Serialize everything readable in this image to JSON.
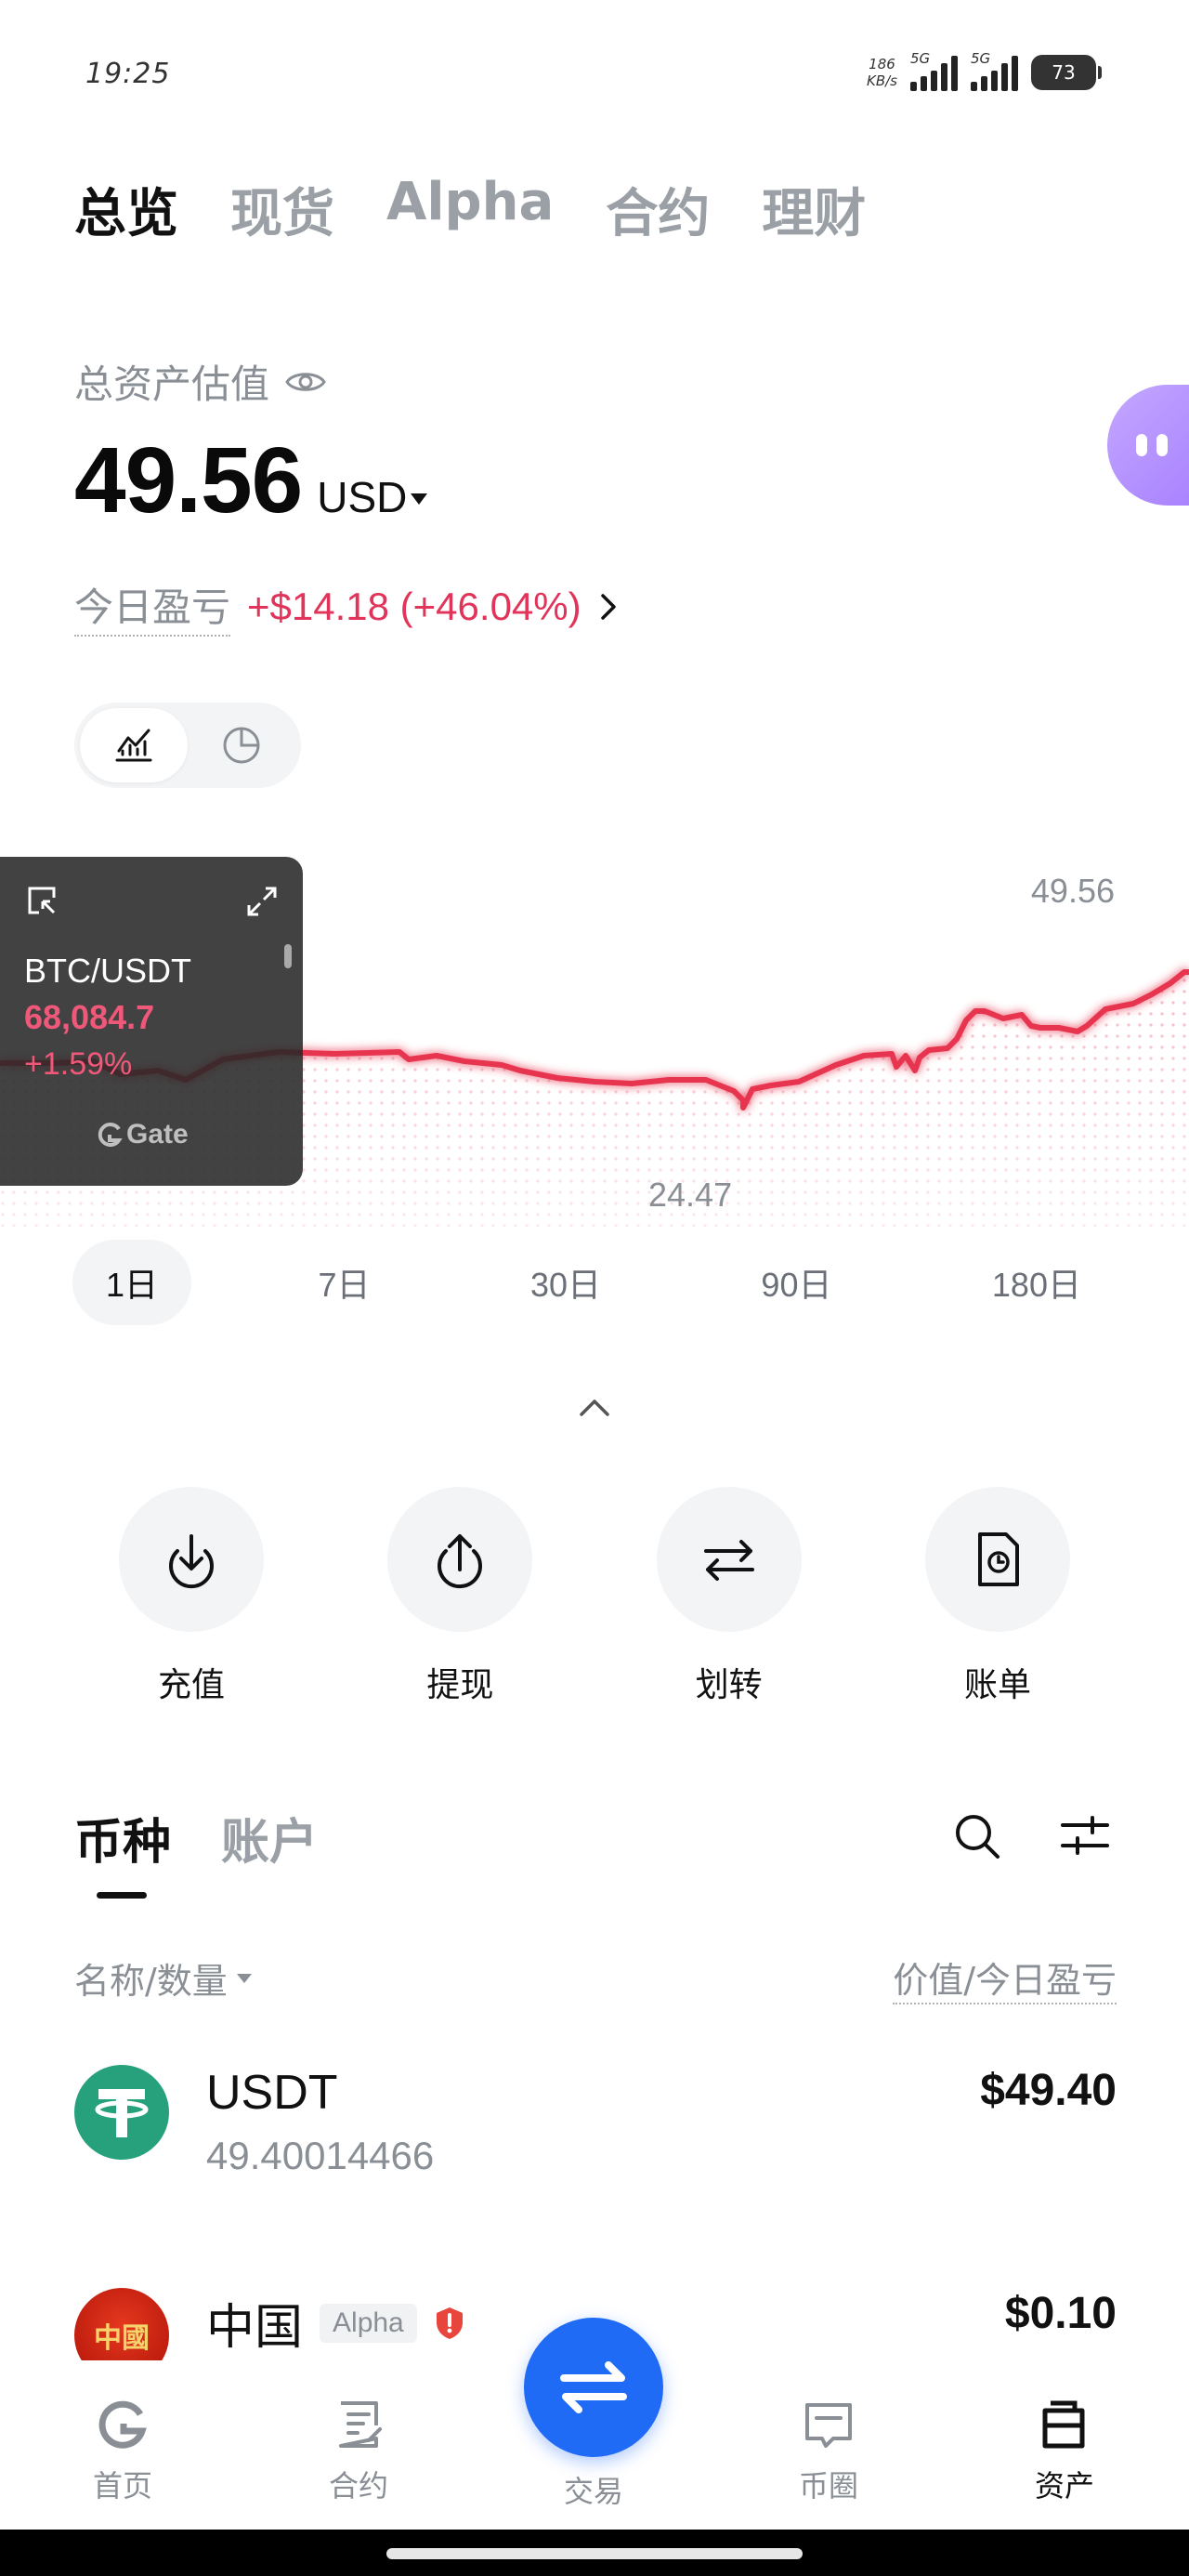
{
  "status_bar": {
    "time": "19:25",
    "net_speed_top": "186",
    "net_speed_bottom": "KB/s",
    "signal1": "5G",
    "signal2": "5G",
    "battery": "73"
  },
  "top_tabs": [
    "总览",
    "现货",
    "Alpha",
    "合约",
    "理财"
  ],
  "summary": {
    "label": "总资产估值",
    "value": "49.56",
    "currency": "USD",
    "pnl_label": "今日盈亏",
    "pnl_value": "+$14.18 (+46.04%)"
  },
  "chart": {
    "max_label": "49.56",
    "min_label": "24.47",
    "line_color": "#e8354f"
  },
  "ticker": {
    "pair": "BTC/USDT",
    "price": "68,084.7",
    "change": "+1.59%",
    "brand": "Gate"
  },
  "periods": [
    "1日",
    "7日",
    "30日",
    "90日",
    "180日"
  ],
  "actions": [
    "充值",
    "提现",
    "划转",
    "账单"
  ],
  "holdings_tabs": [
    "币种",
    "账户"
  ],
  "list_head": {
    "left": "名称/数量",
    "right": "价值/今日盈亏"
  },
  "coins": [
    {
      "symbol": "USDT",
      "amount": "49.40014466",
      "value": "$49.40"
    },
    {
      "symbol": "中国",
      "badge": "Alpha",
      "value": "$0.10",
      "logo_text": "中國"
    }
  ],
  "nav": [
    "首页",
    "合约",
    "交易",
    "币圈",
    "资产"
  ]
}
